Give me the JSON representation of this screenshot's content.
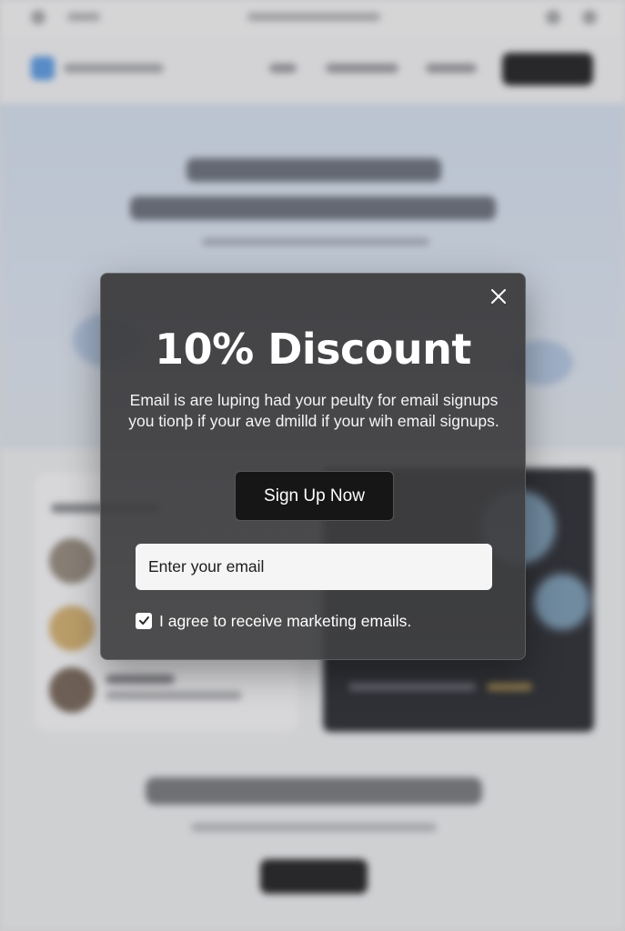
{
  "modal": {
    "title": "10% Discount",
    "description": "Email is are luping had your peulty for email signups you tionþ if your ave dmilld if your wih email signups.",
    "signup_button_label": "Sign Up Now",
    "email_placeholder": "Enter your email",
    "consent_label": "I agree to receive marketing emails.",
    "consent_checked": true,
    "close_icon": "close-icon",
    "checkbox_icon": "checkmark-icon"
  },
  "colors": {
    "modal_background": "#3c3c3e",
    "button_background": "#161617",
    "input_background": "#f5f5f5",
    "text_light": "#ffffff",
    "background_dark_button": "#161618"
  }
}
